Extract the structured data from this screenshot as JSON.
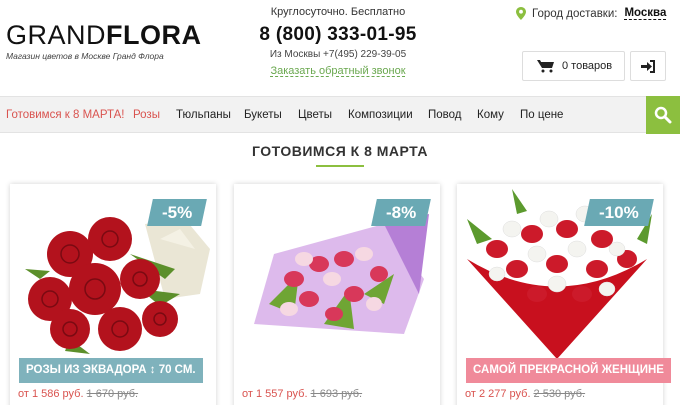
{
  "header": {
    "logo": {
      "thin": "GRAND",
      "bold": "FLORA",
      "subtitle": "Магазин цветов в Москве Гранд Флора"
    },
    "hours": "Круглосуточно. Бесплатно",
    "phone_main": "8 (800) 333-01-95",
    "phone_moscow": "Из Москвы +7(495) 229-39-05",
    "callback": "Заказать обратный звонок",
    "city_label": "Город доставки:",
    "city_value": "Москва",
    "cart_label": "0 товаров"
  },
  "nav": {
    "items": [
      {
        "label": "Готовимся к 8 МАРТА!"
      },
      {
        "label": "Розы"
      },
      {
        "label": "Тюльпаны"
      },
      {
        "label": "Букеты"
      },
      {
        "label": "Цветы"
      },
      {
        "label": "Композиции"
      },
      {
        "label": "Повод"
      },
      {
        "label": "Кому"
      },
      {
        "label": "По цене"
      }
    ]
  },
  "section_title": "ГОТОВИМСЯ К 8 МАРТА",
  "products": [
    {
      "discount": "-5%",
      "label": "РОЗЫ ИЗ ЭКВАДОРА ↕ 70 СМ.",
      "price": "от 1 586 руб.",
      "old_price": "1 670 руб."
    },
    {
      "discount": "-8%",
      "label": "",
      "price": "от 1 557 руб.",
      "old_price": "1 693 руб."
    },
    {
      "discount": "-10%",
      "label": "САМОЙ ПРЕКРАСНОЙ ЖЕНЩИНЕ",
      "price": "от 2 277 руб.",
      "old_price": "2 530 руб."
    }
  ],
  "colors": {
    "accent_green": "#8cbf3f",
    "promo_red": "#d9534f",
    "discount_blue": "#6aa9b4",
    "label_pink": "#f08a9a"
  },
  "icons": [
    "location-pin-icon",
    "cart-icon",
    "login-icon",
    "search-icon"
  ]
}
